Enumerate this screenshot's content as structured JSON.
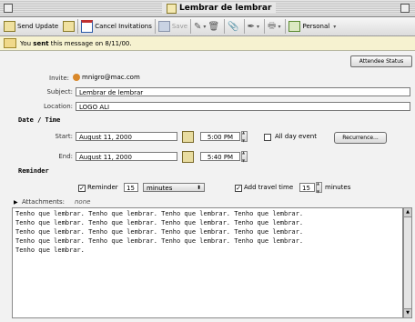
{
  "window": {
    "title": "Lembrar de lembrar"
  },
  "toolbar": {
    "send_update": "Send Update",
    "cancel_invitations": "Cancel Invitations",
    "save": "Save",
    "category": "Personal"
  },
  "info": {
    "prefix": "You ",
    "bold": "sent",
    "suffix": " this message on 8/11/00."
  },
  "attendee_status_button": "Attendee Status",
  "form": {
    "invite_label": "Invite:",
    "invite_value": "mnigro@mac.com",
    "subject_label": "Subject:",
    "subject_value": "Lembrar de lembrar",
    "location_label": "Location:",
    "location_value": "LOGO ALI",
    "date_time_header": "Date / Time",
    "start_label": "Start:",
    "start_date": "August 11, 2000",
    "start_time": "5:00 PM",
    "all_day_label": "All day event",
    "recurrence_button": "Recurrence...",
    "end_label": "End:",
    "end_date": "August 11, 2000",
    "end_time": "5:40 PM",
    "reminder_header": "Reminder",
    "reminder_label": "Reminder",
    "reminder_value": "15",
    "reminder_unit": "minutes",
    "travel_label": "Add travel time",
    "travel_value": "15",
    "travel_unit": "minutes",
    "attachments_label": "Attachments:",
    "attachments_value": "none"
  },
  "body_text": "Tenho que lembrar. Tenho que lembrar. Tenho que lembrar. Tenho que lembrar.\nTenho que lembrar. Tenho que lembrar. Tenho que lembrar. Tenho que lembrar.\nTenho que lembrar. Tenho que lembrar. Tenho que lembrar. Tenho que lembrar.\nTenho que lembrar. Tenho que lembrar. Tenho que lembrar. Tenho que lembrar.\nTenho que lembrar."
}
